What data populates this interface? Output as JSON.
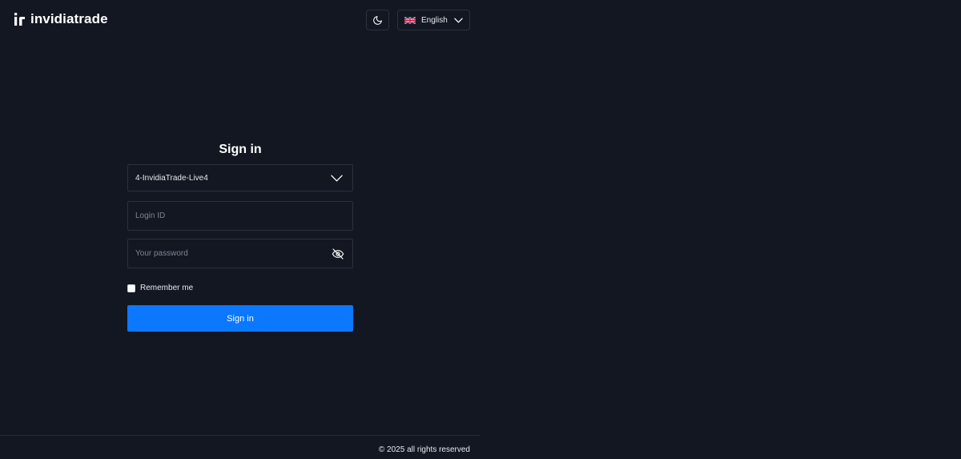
{
  "header": {
    "brand": "invidiatrade",
    "theme_toggle_icon": "moon-icon",
    "language": {
      "label": "English",
      "flag_icon": "uk-flag-icon",
      "chevron_icon": "chevron-down-icon"
    }
  },
  "form": {
    "title": "Sign in",
    "server_select": {
      "value": "4-InvidiaTrade-Live4",
      "chevron_icon": "chevron-down-icon"
    },
    "login_id": {
      "placeholder": "Login ID",
      "value": ""
    },
    "password": {
      "placeholder": "Your password",
      "value": "",
      "toggle_icon": "eye-off-icon"
    },
    "remember_me": {
      "label": "Remember me",
      "checked": false
    },
    "submit_label": "Sign in"
  },
  "footer": {
    "copyright": "© 2025 all rights reserved"
  },
  "colors": {
    "background": "#131722",
    "border": "#2b313f",
    "primary_button": "#0b78ff",
    "text": "#ffffff",
    "placeholder": "#7d8494"
  }
}
